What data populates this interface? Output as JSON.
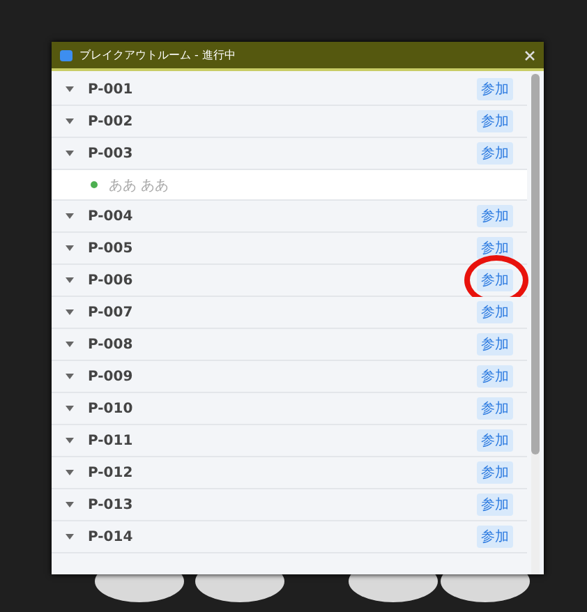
{
  "window": {
    "title": "ブレイクアウトルーム - 進行中"
  },
  "rooms": [
    {
      "name": "P-001",
      "action": "参加"
    },
    {
      "name": "P-002",
      "action": "参加"
    },
    {
      "name": "P-003",
      "action": "参加",
      "participants": [
        {
          "name": "ああ ああ",
          "color": "#4caf50"
        }
      ]
    },
    {
      "name": "P-004",
      "action": "参加"
    },
    {
      "name": "P-005",
      "action": "参加"
    },
    {
      "name": "P-006",
      "action": "参加",
      "highlighted": true
    },
    {
      "name": "P-007",
      "action": "参加"
    },
    {
      "name": "P-008",
      "action": "参加"
    },
    {
      "name": "P-009",
      "action": "参加"
    },
    {
      "name": "P-010",
      "action": "参加"
    },
    {
      "name": "P-011",
      "action": "参加"
    },
    {
      "name": "P-012",
      "action": "参加"
    },
    {
      "name": "P-013",
      "action": "参加"
    },
    {
      "name": "P-014",
      "action": "参加"
    }
  ]
}
